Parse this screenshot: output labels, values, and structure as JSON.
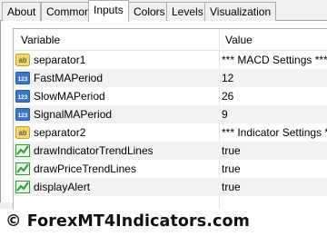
{
  "tabs": [
    {
      "label": "About"
    },
    {
      "label": "Common"
    },
    {
      "label": "Inputs"
    },
    {
      "label": "Colors"
    },
    {
      "label": "Levels"
    },
    {
      "label": "Visualization"
    }
  ],
  "active_tab": "Inputs",
  "table": {
    "headers": {
      "variable": "Variable",
      "value": "Value"
    },
    "rows": [
      {
        "icon": "text-icon",
        "name": "separator1",
        "value": "*** MACD Settings ***"
      },
      {
        "icon": "integer-icon",
        "name": "FastMAPeriod",
        "value": "12"
      },
      {
        "icon": "integer-icon",
        "name": "SlowMAPeriod",
        "value": "26"
      },
      {
        "icon": "integer-icon",
        "name": "SignalMAPeriod",
        "value": "9"
      },
      {
        "icon": "text-icon",
        "name": "separator2",
        "value": "*** Indicator Settings ***"
      },
      {
        "icon": "boolean-icon",
        "name": "drawIndicatorTrendLines",
        "value": "true"
      },
      {
        "icon": "boolean-icon",
        "name": "drawPriceTrendLines",
        "value": "true"
      },
      {
        "icon": "boolean-icon",
        "name": "displayAlert",
        "value": "true"
      }
    ]
  },
  "icon_labels": {
    "text": "ab",
    "integer": "123"
  },
  "footer": {
    "copyright": "© ForexMT4Indicators.com"
  },
  "colors": {
    "text_icon": "#f5d76e",
    "integer_icon": "#3c78c8",
    "boolean_icon": "#2e9e2e"
  }
}
